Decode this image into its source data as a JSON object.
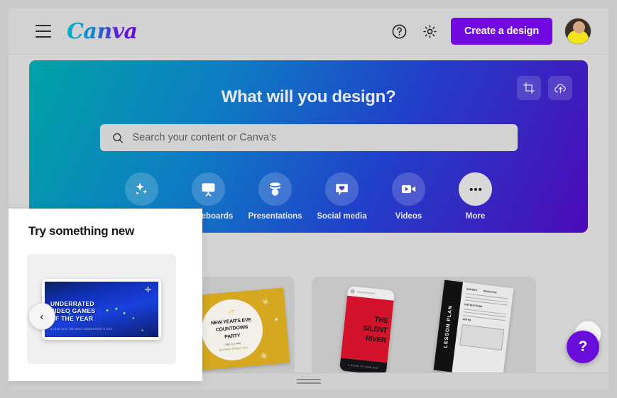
{
  "header": {
    "menu_icon": "hamburger-icon",
    "logo_text": "Canva",
    "help_icon": "question-circle-icon",
    "settings_icon": "gear-icon",
    "create_label": "Create a design",
    "avatar": "user-avatar"
  },
  "hero": {
    "title": "What will you design?",
    "tools": [
      {
        "icon": "crop-icon"
      },
      {
        "icon": "cloud-upload-icon"
      }
    ],
    "search": {
      "placeholder": "Search your content or Canva's",
      "value": "",
      "icon": "search-icon"
    },
    "categories": [
      {
        "label": "",
        "icon": "sparkle-icon"
      },
      {
        "label": "Whiteboards",
        "icon": "whiteboard-icon"
      },
      {
        "label": "Presentations",
        "icon": "presentation-icon"
      },
      {
        "label": "Social media",
        "icon": "heart-bubble-icon"
      },
      {
        "label": "Videos",
        "icon": "video-camera-icon"
      },
      {
        "label": "More",
        "icon": "ellipsis-icon"
      }
    ],
    "gradient_start": "#00a3a6",
    "gradient_end": "#4c0ab8"
  },
  "popup": {
    "title": "Try something new",
    "card": {
      "headline_line1": "UNDERRATED",
      "headline_line2": "VIDEO GAMES",
      "headline_line3": "OF THE YEAR",
      "subtext": "A LOOK INTO THE MOST UNDERRATED TITLES",
      "badge_icon": "dpad-icon"
    }
  },
  "cards": [
    {
      "name": "new-years-eve-countdown-party",
      "title_line1": "NEW YEAR'S EVE",
      "title_line2": "COUNTDOWN",
      "title_line3": "PARTY",
      "subtext": "DEC 31 | 9PM",
      "subtext2": "123 PARTY STREET, CITY",
      "color": "#d5a820"
    },
    {
      "name": "the-silent-river",
      "title_line1": "THE",
      "title_line2": "SILENT",
      "title_line3": "RIVER",
      "footer_text": "A NOVEL BY JANE DOE",
      "color": "#d3122b"
    },
    {
      "name": "lesson-plan",
      "spine_label": "LESSON PLAN",
      "header1": "SUBJECT",
      "header2": "OBJECTIVE",
      "header3": "INSTRUCTIONS",
      "header4": "NOTES",
      "color": "#111114"
    }
  ],
  "carousel": {
    "prev_label": "‹",
    "next_label": "›"
  },
  "help_fab": {
    "label": "?",
    "color": "#6a0ddb"
  },
  "footer": {
    "handle": "resize-handle"
  }
}
